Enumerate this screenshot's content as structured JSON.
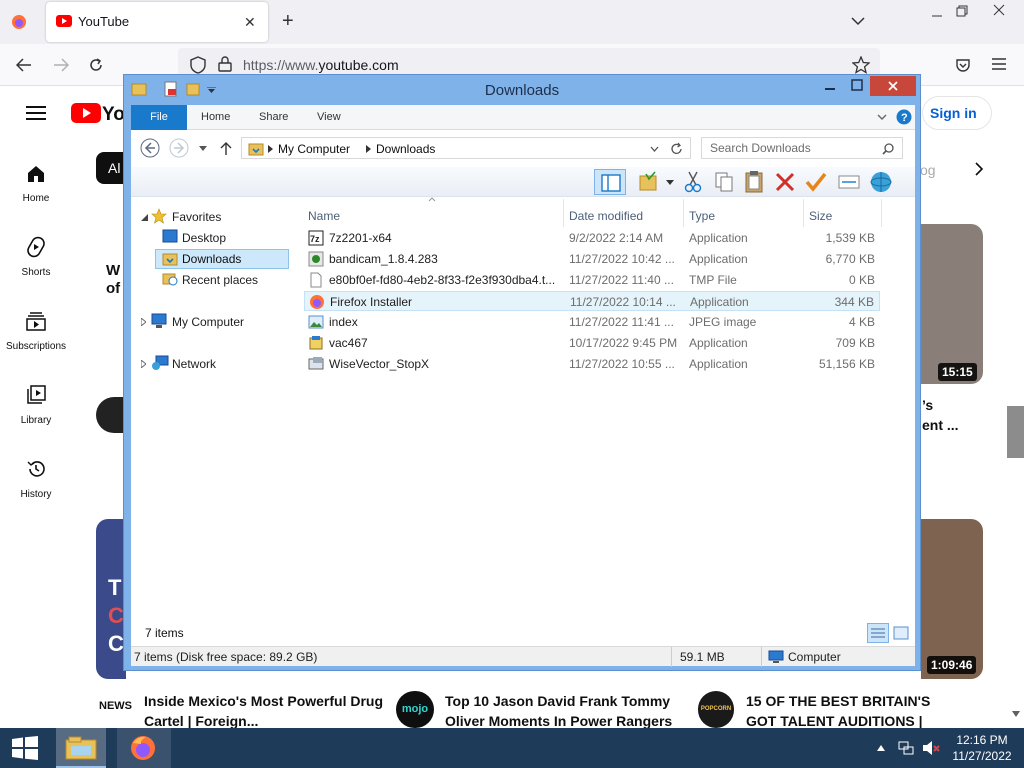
{
  "browser": {
    "tab_title": "YouTube",
    "tab_close": "✕",
    "new_tab": "+",
    "url_prefix": "https://www.",
    "url_domain": "youtube.com"
  },
  "youtube": {
    "sign_in": "Sign in",
    "chip_partial": "Al",
    "sidebar": [
      {
        "label": "Home",
        "icon": "home-icon"
      },
      {
        "label": "Shorts",
        "icon": "shorts-icon"
      },
      {
        "label": "Subscriptions",
        "icon": "subscriptions-icon"
      },
      {
        "label": "Library",
        "icon": "library-icon"
      },
      {
        "label": "History",
        "icon": "history-icon"
      }
    ],
    "durations": [
      "15:15",
      "1:09:46"
    ],
    "partial_text_1": "W",
    "partial_text_2": "of",
    "partial_text_3": "’s",
    "partial_text_4": "ent ...",
    "partial_text_5": "og",
    "thumb_letters": [
      "T",
      "C",
      "C"
    ],
    "videos": [
      {
        "title": "Inside Mexico's Most Powerful Drug Cartel | Foreign...",
        "channel_badge": "NEWS"
      },
      {
        "title": "Top 10 Jason David Frank Tommy Oliver Moments In Power Rangers",
        "channel_badge": "mojo"
      },
      {
        "title": "15 OF THE BEST BRITAIN'S GOT TALENT AUDITIONS | Popcorn",
        "channel_badge": "POPCORN"
      }
    ]
  },
  "explorer": {
    "title": "Downloads",
    "ribbon_tabs": [
      "File",
      "Home",
      "Share",
      "View"
    ],
    "breadcrumb": [
      "My Computer",
      "Downloads"
    ],
    "search_placeholder": "Search Downloads",
    "nav": {
      "favorites": "Favorites",
      "desktop": "Desktop",
      "downloads": "Downloads",
      "recent": "Recent places",
      "computer": "My Computer",
      "network": "Network"
    },
    "columns": [
      "Name",
      "Date modified",
      "Type",
      "Size"
    ],
    "files": [
      {
        "name": "7z2201-x64",
        "date": "9/2/2022 2:14 AM",
        "type": "Application",
        "size": "1,539 KB",
        "icon": "7zip-icon"
      },
      {
        "name": "bandicam_1.8.4.283",
        "date": "11/27/2022 10:42 ...",
        "type": "Application",
        "size": "6,770 KB",
        "icon": "bandicam-icon"
      },
      {
        "name": "e80bf0ef-fd80-4eb2-8f33-f2e3f930dba4.t...",
        "date": "11/27/2022 11:40 ...",
        "type": "TMP File",
        "size": "0 KB",
        "icon": "blank-file-icon"
      },
      {
        "name": "Firefox Installer",
        "date": "11/27/2022 10:14 ...",
        "type": "Application",
        "size": "344 KB",
        "icon": "firefox-installer-icon"
      },
      {
        "name": "index",
        "date": "11/27/2022 11:41 ...",
        "type": "JPEG image",
        "size": "4 KB",
        "icon": "image-file-icon"
      },
      {
        "name": "vac467",
        "date": "10/17/2022 9:45 PM",
        "type": "Application",
        "size": "709 KB",
        "icon": "installer-icon"
      },
      {
        "name": "WiseVector_StopX",
        "date": "11/27/2022 10:55 ...",
        "type": "Application",
        "size": "51,156 KB",
        "icon": "setup-icon"
      }
    ],
    "item_count": "7 items",
    "status_left": "7 items (Disk free space: 89.2 GB)",
    "status_size": "59.1 MB",
    "status_location": "Computer"
  },
  "taskbar": {
    "time": "12:16 PM",
    "date": "11/27/2022"
  }
}
